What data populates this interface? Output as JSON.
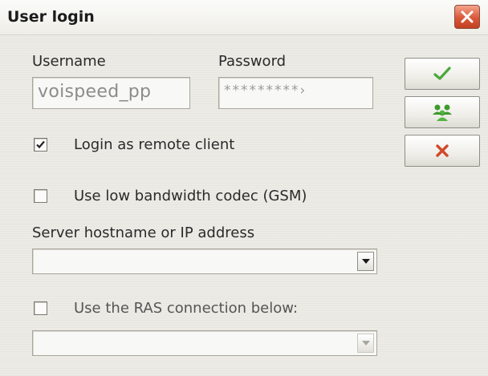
{
  "window": {
    "title": "User login",
    "close_icon": "close-x-icon",
    "close_color": "#d9583a"
  },
  "credentials": {
    "username_label": "Username",
    "username_value": "voispeed_pp",
    "password_label": "Password",
    "password_value": "*********›"
  },
  "options": {
    "remote_client": {
      "label": "Login as remote client",
      "checked": true
    },
    "low_bandwidth": {
      "label": "Use low bandwidth codec (GSM)",
      "checked": false
    },
    "server_label": "Server hostname or IP address",
    "server_value": "",
    "ras": {
      "label": "Use the RAS connection below:",
      "checked": false
    },
    "ras_value": ""
  },
  "buttons": [
    {
      "name": "ok-button",
      "icon": "green-checkmark-icon"
    },
    {
      "name": "users-button",
      "icon": "green-users-group-icon"
    },
    {
      "name": "cancel-button",
      "icon": "red-x-icon"
    }
  ],
  "colors": {
    "ok_icon": "#4aa83a",
    "users_icon": "#3e9a2e",
    "cancel_icon": "#d04a2a"
  }
}
